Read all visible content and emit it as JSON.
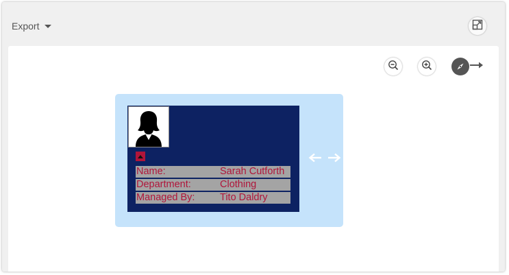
{
  "toolbar": {
    "export_label": "Export",
    "icons": {
      "export_caret": "caret-down-icon",
      "expand": "expand-icon"
    }
  },
  "canvas_controls": {
    "zoom_out_icon": "zoom-out-icon",
    "zoom_in_icon": "zoom-in-icon",
    "navigate_icon": "compass-icon"
  },
  "org_card": {
    "photo_icon": "female-avatar-icon",
    "collapse_icon": "triangle-up-icon",
    "fields": [
      {
        "label": "Name:",
        "value": "Sarah Cutforth"
      },
      {
        "label": "Department:",
        "value": "Clothing"
      },
      {
        "label": "Managed By:",
        "value": "Tito Daldry"
      }
    ],
    "colors": {
      "card_background": "#0d2262",
      "highlight_background": "#c5e3fb",
      "row_background": "#a4a4a4",
      "text": "#b0153a"
    }
  }
}
